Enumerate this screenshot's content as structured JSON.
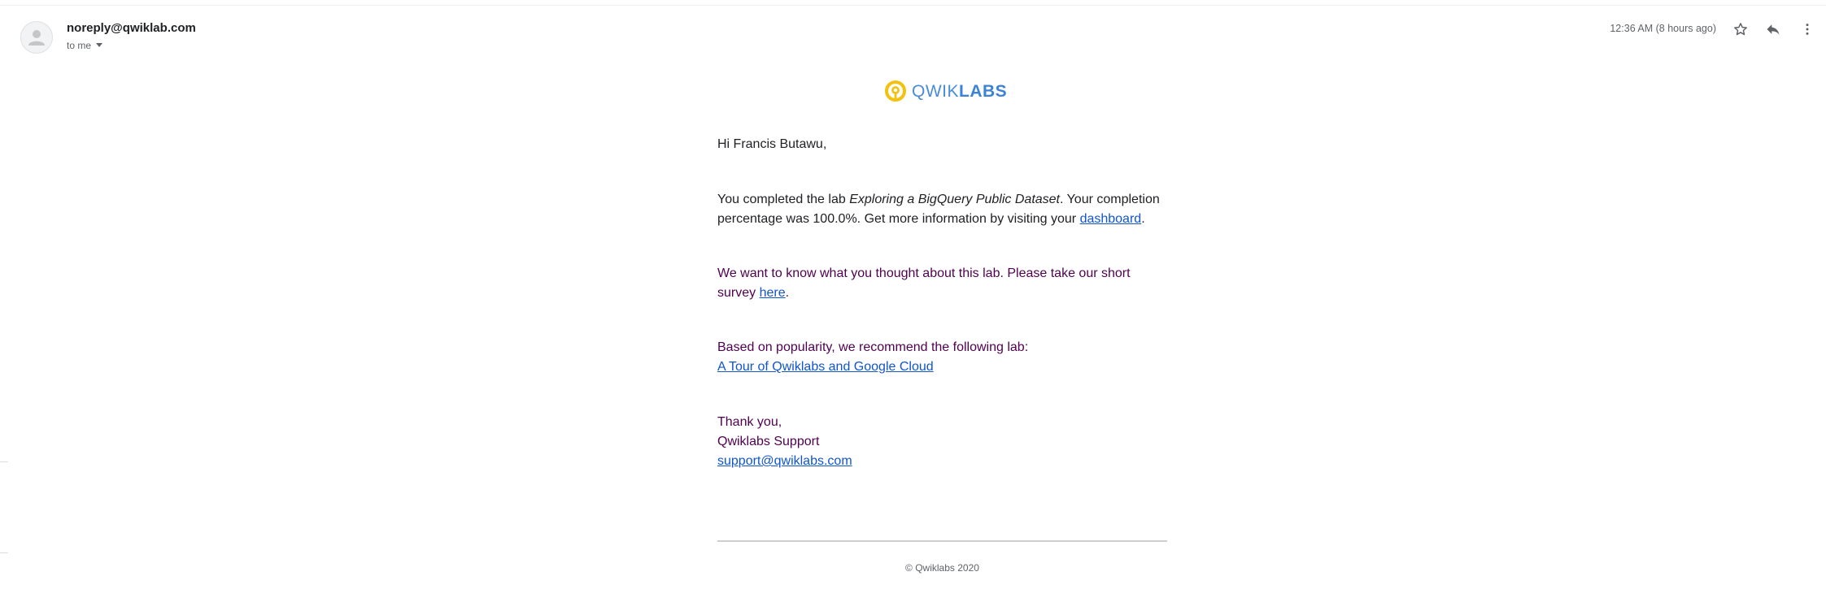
{
  "header": {
    "sender": "noreply@qwiklab.com",
    "recipient_label": "to me",
    "timestamp": "12:36 AM (8 hours ago)",
    "icons": {
      "avatar": "person-icon",
      "star": "star-icon",
      "reply": "reply-icon",
      "more": "more-vert-icon",
      "recipient_details": "caret-down-icon"
    }
  },
  "logo": {
    "word_light": "QWIK",
    "word_bold": "LABS",
    "colors": {
      "mark": "#f4c20d",
      "text": "#3c82d6"
    }
  },
  "body": {
    "greeting": "Hi Francis Butawu,",
    "completion": {
      "prefix": "You completed the lab ",
      "lab_name": "Exploring a BigQuery Public Dataset",
      "middle": ". Your completion",
      "line2_prefix": "percentage was 100.0%. Get more information by visiting your ",
      "dashboard_link": "dashboard",
      "suffix": "."
    },
    "survey": {
      "line1": "We want to know what you thought about this lab. Please take our short",
      "line2_prefix": "survey ",
      "link": "here",
      "suffix": "."
    },
    "recommendation": {
      "intro": "Based on popularity, we recommend the following lab:",
      "lab_link": "A Tour of Qwiklabs and Google Cloud"
    },
    "signoff": {
      "thanks": "Thank you,",
      "team": "Qwiklabs Support",
      "email": "support@qwiklabs.com"
    }
  },
  "footer": {
    "copyright": "© Qwiklabs 2020"
  },
  "colors": {
    "purple_text": "#500050",
    "link": "#1155cc",
    "muted": "#5f6368"
  }
}
